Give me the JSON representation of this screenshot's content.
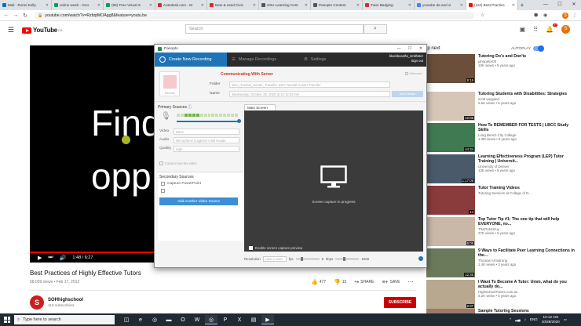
{
  "browser": {
    "tabs": [
      {
        "label": "Mail - Ronni Kelly",
        "icon": "mail-icon",
        "color": "#0072c6"
      },
      {
        "label": "online week - Goo",
        "icon": "sheets-icon",
        "color": "#0f9d58"
      },
      {
        "label": "(86) Free Visual S",
        "icon": "sheets-icon",
        "color": "#0f9d58"
      },
      {
        "label": "Autodesk.com - M",
        "icon": "autodesk-icon",
        "color": "#d32f2f"
      },
      {
        "label": "New & used Civic",
        "icon": "car-icon",
        "color": "#d32f2f"
      },
      {
        "label": "SSU Learning Cent",
        "icon": "doc-icon",
        "color": "#555555"
      },
      {
        "label": "Panopto Content",
        "icon": "panopto-icon",
        "color": "#555555"
      },
      {
        "label": "Tutor Badging",
        "icon": "doc-icon",
        "color": "#d32f2f"
      },
      {
        "label": "youtube da and vi",
        "icon": "google-icon",
        "color": "#4285f4"
      },
      {
        "label": "(112) Best Practice",
        "icon": "youtube-icon",
        "color": "#ff0000",
        "active": true
      }
    ],
    "url": "youtube.com/watch?v=RzbqtMOAgg8&feature=youtu.be"
  },
  "youtube": {
    "logo_text": "YouTube",
    "logo_sup": "CA",
    "search_placeholder": "Search",
    "notif_count": "9+",
    "avatar_letter": "S"
  },
  "player": {
    "text_line1": "Find",
    "text_line2": "opp",
    "time": "1:48 / 6:27",
    "progress_fraction": 0.95
  },
  "video": {
    "title": "Best Practices of Highly Effective Tutors",
    "meta": "58,039 views • Feb 17, 2012",
    "likes": "477",
    "dislikes": "15",
    "share": "SHARE",
    "save": "SAVE",
    "channel": "SOHhighschool",
    "subscribers": "116 subscribers",
    "channel_letter": "S",
    "subscribe": "SUBSCRIBE"
  },
  "sidebar": {
    "up_next": "Up next",
    "autoplay": "AUTOPLAY",
    "items": [
      {
        "title": "Tutoring Do's and Don'ts",
        "channel": "johnpeter00",
        "views": "10K views • 5 years ago",
        "duration": "9:15",
        "thumb": "#6b4f3a"
      },
      {
        "title": "Tutoring Students with Disabilities: Strategies",
        "channel": "scott weigand",
        "views": "5.6K views • 6 years ago",
        "duration": "12:06",
        "thumb": "#d6c6b8"
      },
      {
        "title": "How To REMEMBER FOR TESTS | LBCC Study Skills",
        "channel": "Long Beach City College",
        "views": "1.3M views • 9 years ago",
        "duration": "44:34",
        "thumb": "#3f7a52"
      },
      {
        "title": "Learning Effectiveness Program (LEP) Tutor Training | Universit...",
        "channel": "University of Denver",
        "views": "12K views • 9 years ago",
        "duration": "1:17:09",
        "thumb": "#4a5a6a"
      },
      {
        "title": "Tutor Training Videos",
        "channel": "Tutoring Services at College of D...",
        "views": "",
        "duration": "14",
        "thumb": "#8a3b3b"
      },
      {
        "title": "Top Tutor Tip #1: The one tip that will help EVERYONE, no...",
        "channel": "ThatTutorGuy",
        "views": "27K views • 6 years ago",
        "duration": "6:05",
        "thumb": "#c9b8a8"
      },
      {
        "title": "9 Ways to Facilitate Peer Learning Connections in the...",
        "channel": "Thomas Armstrong",
        "views": "1.4K views • 3 years ago",
        "duration": "12:35",
        "thumb": "#6a7a5a"
      },
      {
        "title": "I Want To Become A Tutor: Umm, what do you actually do...",
        "channel": "HighSchoolTutors.com.au",
        "views": "5.2K views • 5 years ago",
        "duration": "2:37",
        "thumb": "#b8a890"
      },
      {
        "title": "Sample Tutoring Sessions",
        "channel": "",
        "views": "",
        "duration": "",
        "thumb": "#9a7a6a"
      }
    ]
  },
  "panopto": {
    "window_title": "Panopto",
    "tabs": [
      "Create New Recording",
      "Manage Recordings",
      "Settings"
    ],
    "user": "blackboard\\s_smithster",
    "sign_out": "Sign out",
    "status": "Communicating With Server",
    "record_label": "Record",
    "webcast_label": "Webcast",
    "folder_label": "Folder",
    "folder_value": "SSU_Tutorial_Center_Transfer: SSU Tutorial Center Transfer",
    "name_label": "Name",
    "name_value": "Wednesday, October 28, 2020 at 10:12:03 AM",
    "details_button": "Add Details",
    "primary_sources": "Primary Sources",
    "video_label": "Video",
    "video_value": "None",
    "audio_label": "Audio",
    "audio_value": "Microphone (Logitech USB Heads",
    "quality_label": "Quality",
    "quality_value": "High",
    "low_res": "Capture low-res video",
    "secondary_sources": "Secondary Sources",
    "capture_ppt": "Capture PowerPoint",
    "add_source": "Add Another Video Source",
    "main_screen": "Main Screen",
    "capture_text": "Screen capture in progress",
    "preview_label": "Enable screen capture preview",
    "resolution_label": "Resolution",
    "resolution_value": "1600 x 1080",
    "fps_label": "fps",
    "fps_value": "8",
    "kbps_label": "kbps",
    "kbps_value": "1500"
  },
  "taskbar": {
    "search_placeholder": "Type here to search",
    "lang": "ENG",
    "time": "10:12 AM",
    "date": "10/28/2020"
  }
}
